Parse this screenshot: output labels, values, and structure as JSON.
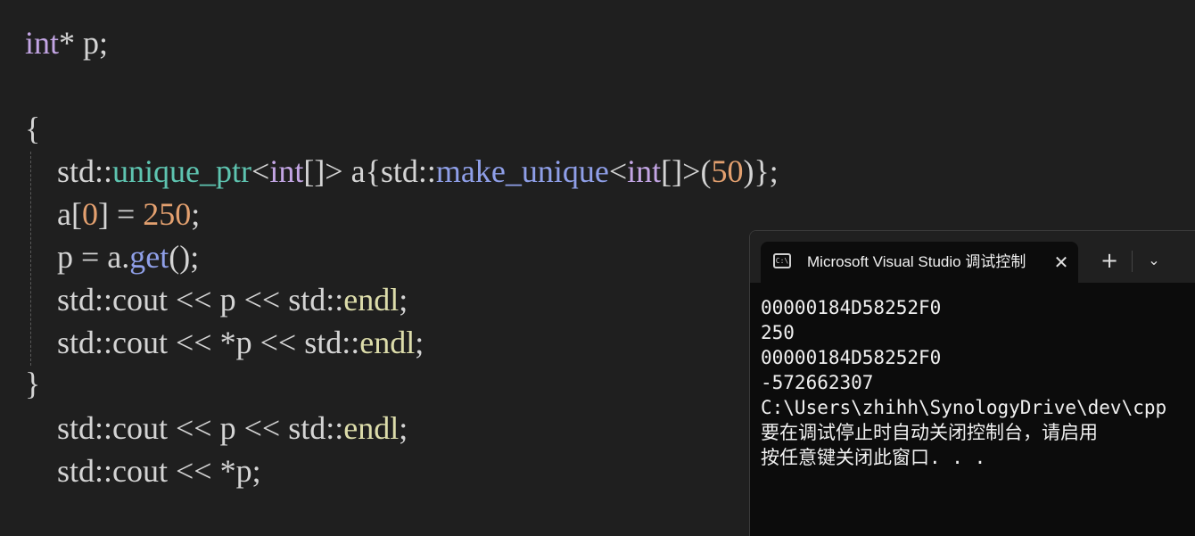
{
  "editor": {
    "lines": [
      {
        "tokens": [
          {
            "t": "int",
            "c": "kw"
          },
          {
            "t": "* p;",
            "c": "ns"
          }
        ]
      },
      {
        "tokens": []
      },
      {
        "tokens": [
          {
            "t": "{",
            "c": "brace1"
          }
        ]
      },
      {
        "tokens": [
          {
            "t": "    std::",
            "c": "ns"
          },
          {
            "t": "unique_ptr",
            "c": "type"
          },
          {
            "t": "<",
            "c": "ns"
          },
          {
            "t": "int",
            "c": "kw"
          },
          {
            "t": "[]> a{std::",
            "c": "ns"
          },
          {
            "t": "make_unique",
            "c": "fn"
          },
          {
            "t": "<",
            "c": "ns"
          },
          {
            "t": "int",
            "c": "kw"
          },
          {
            "t": "[]>(",
            "c": "ns"
          },
          {
            "t": "50",
            "c": "num"
          },
          {
            "t": ")};",
            "c": "ns"
          }
        ]
      },
      {
        "tokens": [
          {
            "t": "    a[",
            "c": "ns"
          },
          {
            "t": "0",
            "c": "num"
          },
          {
            "t": "] = ",
            "c": "ns"
          },
          {
            "t": "250",
            "c": "num"
          },
          {
            "t": ";",
            "c": "ns"
          }
        ]
      },
      {
        "tokens": [
          {
            "t": "    p = a.",
            "c": "ns"
          },
          {
            "t": "get",
            "c": "fn"
          },
          {
            "t": "();",
            "c": "ns"
          }
        ]
      },
      {
        "tokens": [
          {
            "t": "    std::cout << p << std::",
            "c": "ns"
          },
          {
            "t": "endl",
            "c": "endl"
          },
          {
            "t": ";",
            "c": "ns"
          }
        ]
      },
      {
        "tokens": [
          {
            "t": "    std::cout << *p << std::",
            "c": "ns"
          },
          {
            "t": "endl",
            "c": "endl"
          },
          {
            "t": ";",
            "c": "ns"
          }
        ]
      },
      {
        "tokens": [
          {
            "t": "}",
            "c": "brace1"
          }
        ]
      },
      {
        "tokens": [
          {
            "t": "    std::cout << p << std::",
            "c": "ns"
          },
          {
            "t": "endl",
            "c": "endl"
          },
          {
            "t": ";",
            "c": "ns"
          }
        ]
      },
      {
        "tokens": [
          {
            "t": "    std::cout << *p;",
            "c": "ns"
          }
        ]
      }
    ]
  },
  "terminal": {
    "tab_icon": "C:\\",
    "tab_title": "Microsoft Visual Studio 调试控制台",
    "close_glyph": "✕",
    "new_tab_glyph": "+",
    "dropdown_glyph": "⌄",
    "output": [
      "00000184D58252F0",
      "250",
      "00000184D58252F0",
      "-572662307",
      "C:\\Users\\zhihh\\SynologyDrive\\dev\\cpp",
      "要在调试停止时自动关闭控制台，请启用",
      "按任意键关闭此窗口. . ."
    ]
  },
  "colors": {
    "keyword": "#c3a5e4",
    "type": "#5ec4b0",
    "function": "#8f9fe8",
    "number": "#e3a06f",
    "default": "#d4d4d4"
  }
}
